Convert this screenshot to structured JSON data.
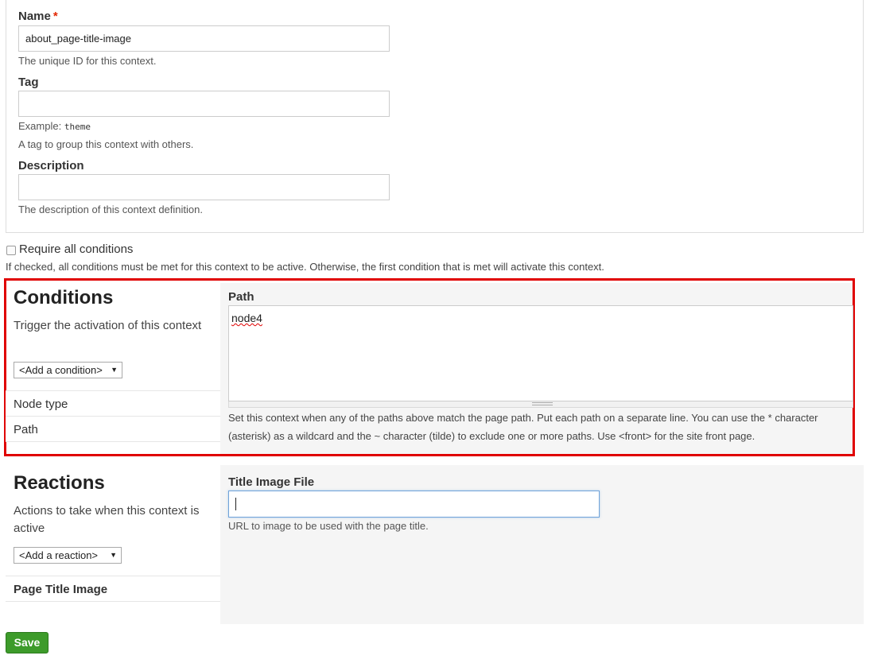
{
  "form": {
    "name_label": "Name",
    "required_mark": "*",
    "name_value": "about_page-title-image",
    "name_desc": "The unique ID for this context.",
    "tag_label": "Tag",
    "tag_value": "",
    "tag_example_prefix": "Example:",
    "tag_example_code": "theme",
    "tag_desc": "A tag to group this context with others.",
    "description_label": "Description",
    "description_value": "",
    "description_desc": "The description of this context definition."
  },
  "require_all": {
    "label": "Require all conditions",
    "checked": false,
    "desc": "If checked, all conditions must be met for this context to be active. Otherwise, the first condition that is met will activate this context."
  },
  "conditions": {
    "title": "Conditions",
    "subtitle": "Trigger the activation of this context",
    "select_value": "<Add a condition>",
    "items": [
      "Node type",
      "Path"
    ],
    "path_label": "Path",
    "path_value": "node4",
    "path_desc": "Set this context when any of the paths above match the page path. Put each path on a separate line. You can use the * character (asterisk) as a wildcard and the ~ character (tilde) to exclude one or more paths. Use <front> for the site front page.",
    "highlight_color": "#e00000"
  },
  "reactions": {
    "title": "Reactions",
    "subtitle": "Actions to take when this context is active",
    "select_value": "<Add a reaction>",
    "items": [
      "Page Title Image"
    ],
    "field_label": "Title Image File",
    "field_value": "",
    "field_desc": "URL to image to be used with the page title."
  },
  "actions": {
    "save_label": "Save",
    "save_color": "#3d9b2a"
  }
}
